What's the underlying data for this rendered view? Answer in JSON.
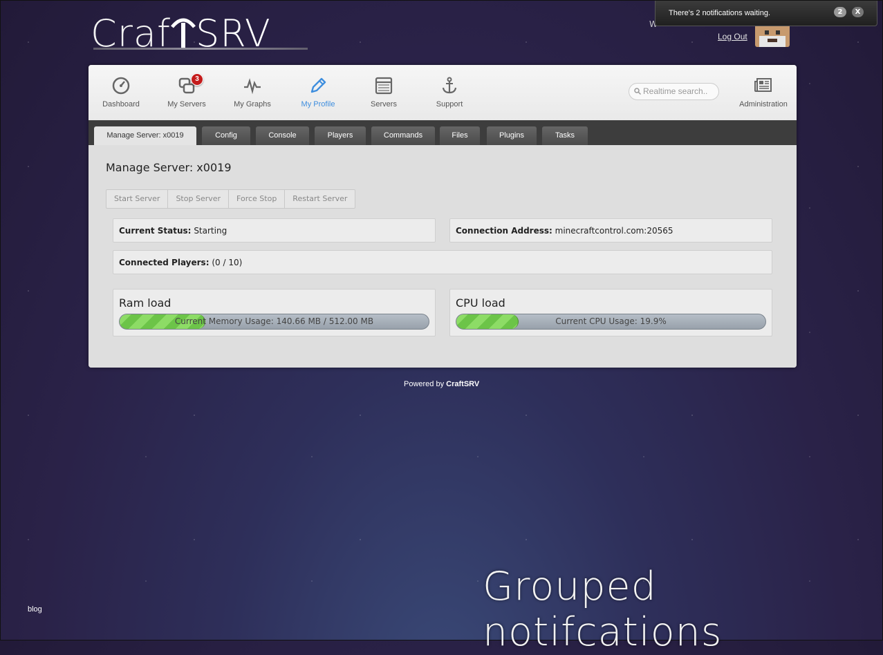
{
  "brand": {
    "logo_part1": "Craf",
    "logo_part2": "SRV"
  },
  "user": {
    "welcome": "W",
    "logout_label": "Log Out"
  },
  "notification": {
    "text": "There's 2 notifications waiting.",
    "count": "2",
    "close_label": "X"
  },
  "nav": {
    "items": [
      {
        "label": "Dashboard",
        "icon": "dashboard-gauge-icon"
      },
      {
        "label": "My Servers",
        "icon": "servers-stack-icon",
        "badge": "3"
      },
      {
        "label": "My Graphs",
        "icon": "graph-pulse-icon"
      },
      {
        "label": "My Profile",
        "icon": "pencil-icon",
        "active": true
      },
      {
        "label": "Servers",
        "icon": "list-window-icon"
      },
      {
        "label": "Support",
        "icon": "anchor-icon"
      },
      {
        "label": "Administration",
        "icon": "newspaper-icon"
      }
    ],
    "search_placeholder": "Realtime search.."
  },
  "tabs": [
    "Manage Server: x0019",
    "Config",
    "Console",
    "Players",
    "Commands",
    "Files",
    "Plugins",
    "Tasks"
  ],
  "page": {
    "title": "Manage Server: x0019",
    "actions": [
      "Start Server",
      "Stop Server",
      "Force Stop",
      "Restart Server"
    ],
    "status_label": "Current Status:",
    "status_value": "Starting",
    "address_label": "Connection Address:",
    "address_value": "minecraftcontrol.com:20565",
    "players_label": "Connected Players:",
    "players_value": "(0 / 10)"
  },
  "loads": {
    "ram": {
      "title": "Ram load",
      "label": "Current Memory Usage: 140.66 MB / 512.00 MB",
      "fraction": 0.275
    },
    "cpu": {
      "title": "CPU load",
      "label": "Current CPU Usage: 19.9%",
      "fraction": 0.199
    }
  },
  "footer": {
    "powered_prefix": "Powered by",
    "powered_brand": "CraftSRV",
    "blog": "blog"
  },
  "caption": "Grouped notifcations",
  "colors": {
    "accent": "#3e8ede",
    "badge": "#c41c1c",
    "progress": "#7ccf55"
  }
}
